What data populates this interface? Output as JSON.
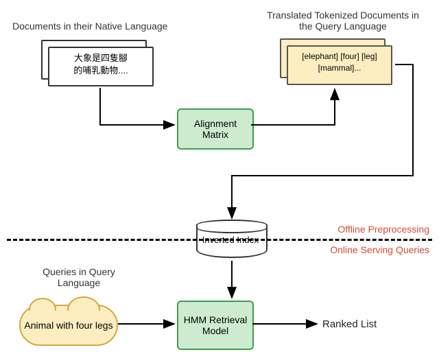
{
  "labels": {
    "native_docs_caption": "Documents in their Native Language",
    "translated_docs_caption": "Translated Tokenized Documents in the Query Language",
    "queries_caption": "Queries in Query Language"
  },
  "native_doc_text_line1": "大象是四隻腳",
  "native_doc_text_line2": "的哺乳動物....",
  "translated_doc_tokens_line1": "[elephant] [four] [leg]",
  "translated_doc_tokens_line2": "[mammal]...",
  "alignment_box": "Alignment Matrix",
  "inverted_index": "Inverted Index",
  "query_cloud": "Animal with four legs",
  "hmm_box": "HMM Retrieval Model",
  "output": "Ranked List",
  "sections": {
    "offline": "Offline Preprocessing",
    "online": "Online Serving Queries"
  }
}
